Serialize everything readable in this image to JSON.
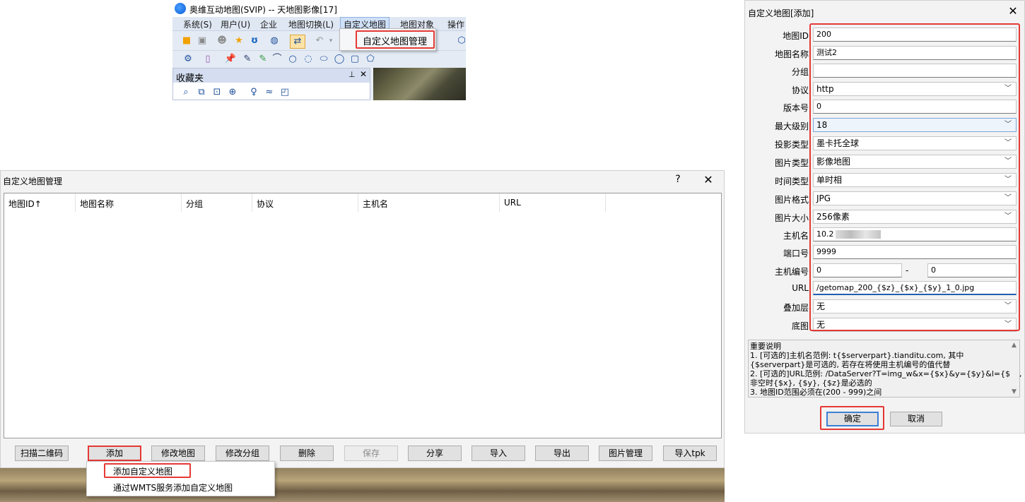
{
  "app": {
    "title": "奥维互动地图(SVIP) -- 天地图影像[17]",
    "menu": [
      "系统(S)",
      "用户(U)",
      "企业",
      "地图切换(L)",
      "自定义地图",
      "地图对象",
      "操作"
    ],
    "dropdown_item": "自定义地图管理",
    "favorites_title": "收藏夹"
  },
  "manager": {
    "title": "自定义地图管理",
    "help": "?",
    "close": "✕",
    "columns": [
      "地图ID↑",
      "地图名称",
      "分组",
      "协议",
      "主机名",
      "URL"
    ],
    "buttons": [
      "扫描二维码",
      "添加",
      "修改地图",
      "修改分组",
      "删除",
      "保存",
      "分享",
      "导入",
      "导出",
      "图片管理",
      "导入tpk"
    ],
    "popup": [
      "添加自定义地图",
      "通过WMTS服务添加自定义地图"
    ]
  },
  "adder": {
    "title": "自定义地图[添加]",
    "close": "✕",
    "fields": {
      "map_id": {
        "label": "地图ID",
        "value": "200"
      },
      "map_name": {
        "label": "地图名称",
        "value": "测试2"
      },
      "group": {
        "label": "分组",
        "value": ""
      },
      "protocol": {
        "label": "协议",
        "value": "http"
      },
      "version": {
        "label": "版本号",
        "value": "0"
      },
      "max_level": {
        "label": "最大级别",
        "value": "18"
      },
      "projection": {
        "label": "投影类型",
        "value": "墨卡托全球"
      },
      "image_type": {
        "label": "图片类型",
        "value": "影像地图"
      },
      "time_type": {
        "label": "时间类型",
        "value": "单时相"
      },
      "image_format": {
        "label": "图片格式",
        "value": "JPG"
      },
      "image_size": {
        "label": "图片大小",
        "value": "256像素"
      },
      "host": {
        "label": "主机名",
        "value": "10.2"
      },
      "port": {
        "label": "端口号",
        "value": "9999"
      },
      "host_no": {
        "label": "主机编号",
        "from": "0",
        "dash": "-",
        "to": "0"
      },
      "url": {
        "label": "URL",
        "value": "/getomap_200_{$z}_{$x}_{$y}_1_0.jpg"
      },
      "overlay": {
        "label": "叠加层",
        "value": "无"
      },
      "base": {
        "label": "底图",
        "value": "无"
      }
    },
    "notes": [
      "重要说明",
      "1. [可选的]主机名范例: t{$serverpart}.tianditu.com, 其中",
      "{$serverpart}是可选的, 若存在将使用主机编号的值代替",
      "2. [可选的]URL范例: /DataServer?T=img_w&x={$x}&y={$y}&l={$z},",
      "非空时{$x}, {$y}, {$z}是必选的",
      "3. 地图ID范围必须在(200 - 999)之间"
    ],
    "ok": "确定",
    "cancel": "取消"
  },
  "colors": {
    "highlight": "#e53935",
    "accent": "#3c7fd6"
  }
}
